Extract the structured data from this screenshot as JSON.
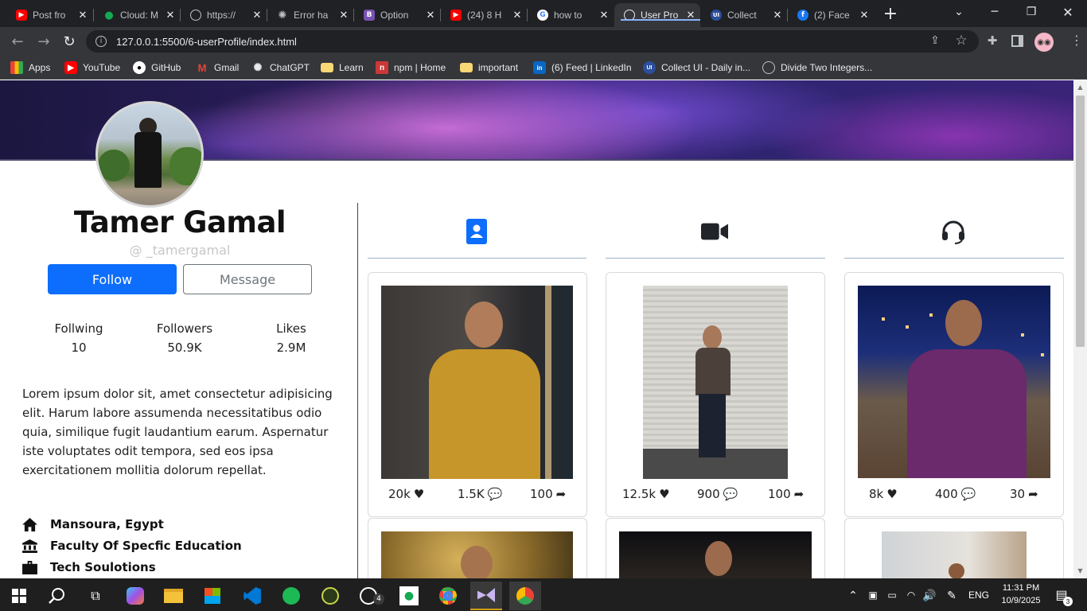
{
  "browser": {
    "tabs": [
      {
        "title": "Post fro",
        "icon": "youtube-icon",
        "color": "#ff0000"
      },
      {
        "title": "Cloud: M",
        "icon": "mongodb-icon",
        "color": "#13aa52"
      },
      {
        "title": "https://",
        "icon": "globe-icon",
        "color": "#9aa0a6"
      },
      {
        "title": "Error ha",
        "icon": "chatgpt-icon",
        "color": "#bdc1c6"
      },
      {
        "title": "Option",
        "icon": "bootstrap-icon",
        "color": "#7952b3"
      },
      {
        "title": "(24) 8 H",
        "icon": "youtube-icon",
        "color": "#ff0000"
      },
      {
        "title": "how to",
        "icon": "google-icon",
        "color": "#4285f4"
      },
      {
        "title": "User Pro",
        "icon": "globe-icon",
        "color": "#9aa0a6"
      },
      {
        "title": "Collect",
        "icon": "collectui-icon",
        "color": "#3b82f6"
      },
      {
        "title": "(2) Face",
        "icon": "facebook-icon",
        "color": "#1877f2"
      }
    ],
    "url": "127.0.0.1:5500/6-userProfile/index.html",
    "bookmarks": [
      {
        "label": "Apps"
      },
      {
        "label": "YouTube"
      },
      {
        "label": "GitHub"
      },
      {
        "label": "Gmail"
      },
      {
        "label": "ChatGPT"
      },
      {
        "label": "Learn"
      },
      {
        "label": "npm | Home"
      },
      {
        "label": "important"
      },
      {
        "label": "(6) Feed | LinkedIn"
      },
      {
        "label": "Collect UI - Daily in..."
      },
      {
        "label": "Divide Two Integers..."
      }
    ]
  },
  "profile": {
    "name": "Tamer Gamal",
    "handle": "@ _tamergamal",
    "follow_label": "Follow",
    "message_label": "Message",
    "stats": [
      {
        "label": "Follwing",
        "value": "10"
      },
      {
        "label": "Followers",
        "value": "50.9K"
      },
      {
        "label": "Likes",
        "value": "2.9M"
      }
    ],
    "bio": "Lorem ipsum dolor sit, amet consectetur adipisicing elit. Harum labore assumenda necessitatibus odio quia, similique fugit laudantium earum. Aspernatur iste voluptates odit tempora, sed eos ipsa exercitationem mollitia dolorum repellat.",
    "info": [
      {
        "icon": "home-icon",
        "text": "Mansoura, Egypt"
      },
      {
        "icon": "university-icon",
        "text": "Faculty Of Specfic Education"
      },
      {
        "icon": "briefcase-icon",
        "text": "Tech Soulotions"
      }
    ],
    "accent": "#0d6efd"
  },
  "content_tabs": [
    {
      "icon": "contact-card-icon",
      "color": "#0d6efd"
    },
    {
      "icon": "video-camera-icon",
      "color": "#212529"
    },
    {
      "icon": "headset-icon",
      "color": "#212529"
    }
  ],
  "posts": [
    {
      "likes": "20k",
      "comments": "1.5K",
      "shares": "100"
    },
    {
      "likes": "12.5k",
      "comments": "900",
      "shares": "100"
    },
    {
      "likes": "8k",
      "comments": "400",
      "shares": "30"
    }
  ],
  "taskbar": {
    "whatsapp_badge": "4",
    "language": "ENG",
    "time": "11:31 PM",
    "date": "10/9/2025",
    "notifications": "3"
  }
}
